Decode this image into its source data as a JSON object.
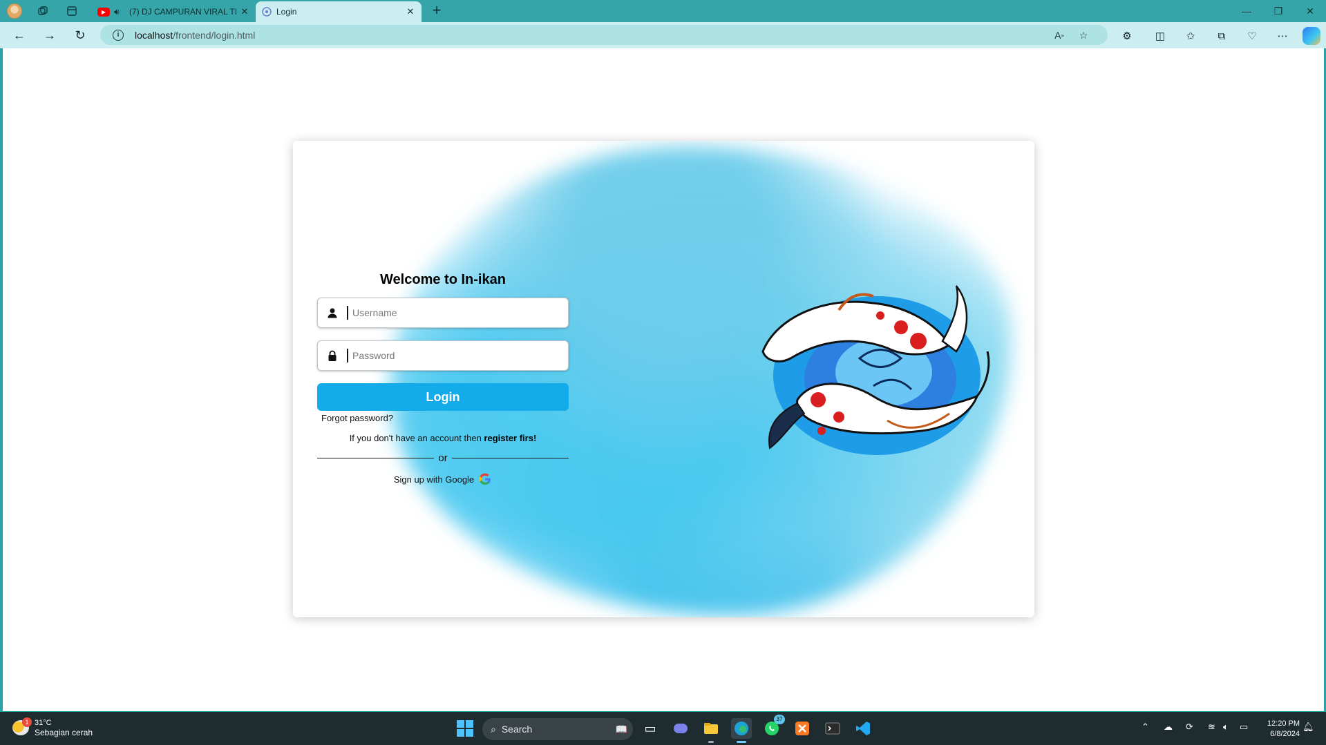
{
  "browser": {
    "tabs": [
      {
        "title": "(7) DJ CAMPURAN VIRAL TI",
        "favicon": "youtube-icon",
        "audio": true
      },
      {
        "title": "Login",
        "favicon": "page-icon",
        "active": true
      }
    ],
    "address": {
      "host": "localhost",
      "path": "/frontend/login.html"
    }
  },
  "page": {
    "heading": "Welcome to In-ikan",
    "username_placeholder": "Username",
    "password_placeholder": "Password",
    "login_label": "Login",
    "forgot_label": "Forgot password?",
    "register_text": "If you don't have an account then ",
    "register_link": "register firs!",
    "or_label": "or",
    "google_label": "Sign up with Google"
  },
  "taskbar": {
    "weather_temp": "31°C",
    "weather_desc": "Sebagian cerah",
    "weather_badge": "1",
    "search_label": "Search",
    "whatsapp_badge": "37",
    "time": "12:20 PM",
    "date": "6/8/2024"
  },
  "colors": {
    "accent": "#13abe9",
    "frame": "#35a5a9",
    "toolbar": "#cdeef0"
  }
}
